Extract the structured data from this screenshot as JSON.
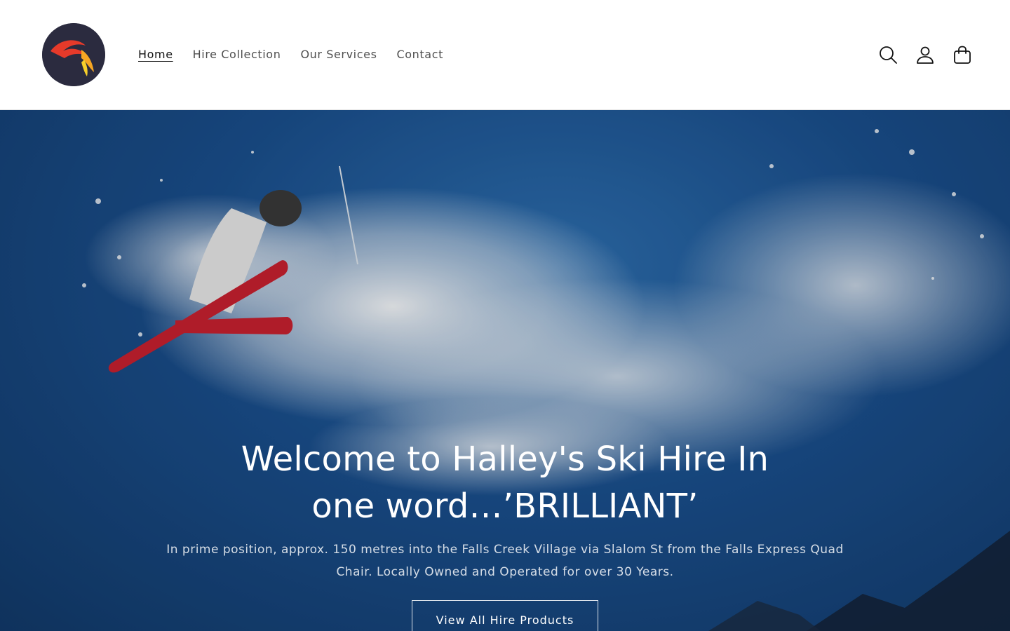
{
  "brand": {
    "logo_icon": "comet-logo-icon",
    "logo_colors": [
      "#2b2b3f",
      "#e63a2a",
      "#f6a623",
      "#f7d02b"
    ]
  },
  "nav": {
    "items": [
      {
        "label": "Home",
        "active": true
      },
      {
        "label": "Hire Collection",
        "active": false
      },
      {
        "label": "Our Services",
        "active": false
      },
      {
        "label": "Contact",
        "active": false
      }
    ]
  },
  "header_icons": [
    "search-icon",
    "account-icon",
    "cart-icon"
  ],
  "hero": {
    "title": "Welcome to Halley's Ski Hire In one word…’BRILLIANT’",
    "subtitle": "In prime position, approx. 150 metres into the Falls Creek Village via Slalom St from the Falls Express Quad Chair. Locally Owned and Operated for over 30 Years.",
    "button_label": "View All Hire Products",
    "background_colors": [
      "#2d6fb0",
      "#1a4f8d",
      "#123a6a"
    ]
  }
}
